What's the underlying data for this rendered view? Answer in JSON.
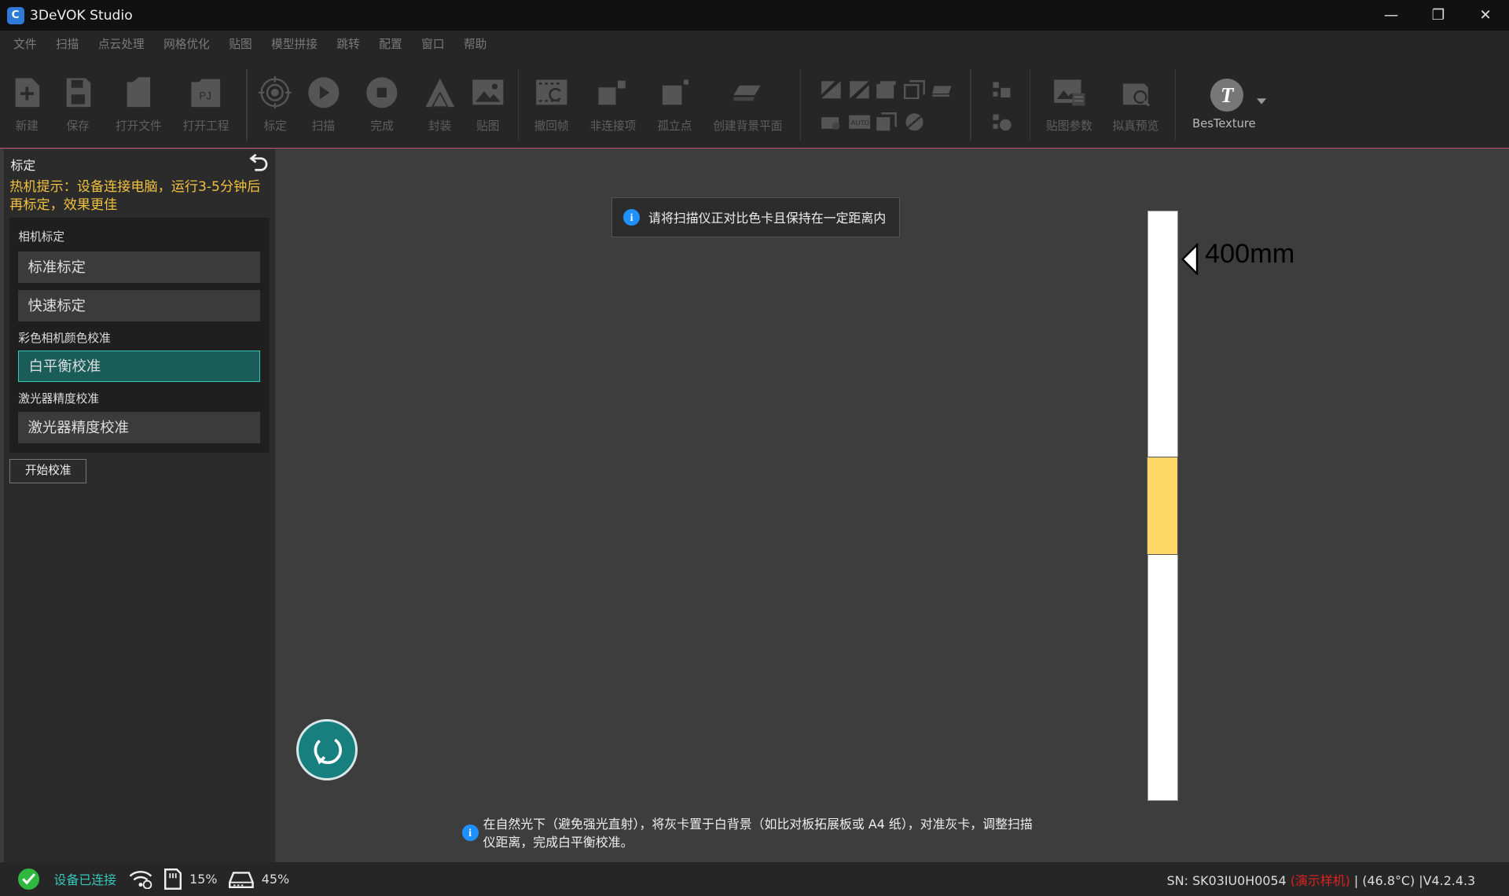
{
  "window": {
    "title": "3DeVOK Studio",
    "logo_letter": "C",
    "controls": {
      "minimize": "—",
      "restore": "❐",
      "close": "✕"
    }
  },
  "menu": [
    "文件",
    "扫描",
    "点云处理",
    "网格优化",
    "贴图",
    "模型拼接",
    "跳转",
    "配置",
    "窗口",
    "帮助"
  ],
  "toolbar": {
    "new": "新建",
    "save": "保存",
    "open_file": "打开文件",
    "open_project": "打开工程",
    "open_project_icon_text": "PJ",
    "calibrate": "标定",
    "scan": "扫描",
    "finish": "完成",
    "encapsulate": "封装",
    "texture": "贴图",
    "undo_frame": "撤回帧",
    "non_connected": "非连接项",
    "isolated_points": "孤立点",
    "create_bg_plane": "创建背景平面",
    "texture_params": "贴图参数",
    "mock_preview": "拟真预览",
    "bestexture": "BesTexture",
    "bestexture_letter": "T"
  },
  "panel": {
    "title": "标定",
    "tip": "热机提示：设备连接电脑，运行3-5分钟后再标定，效果更佳",
    "camera_section": "相机标定",
    "standard_cal": "标准标定",
    "quick_cal": "快速标定",
    "color_section": "彩色相机颜色校准",
    "white_balance": "白平衡校准",
    "laser_section": "激光器精度校准",
    "laser_cal": "激光器精度校准",
    "start_button": "开始校准"
  },
  "viewport": {
    "toast_text": "请将扫描仪正对比色卡且保持在一定距离内",
    "info_glyph": "i",
    "distance_label": "400mm",
    "distance_fill": {
      "start_fraction": 0.417,
      "end_fraction": 0.584
    },
    "hint_text": "在自然光下（避免强光直射），将灰卡置于白背景（如比对板拓展板或 A4 纸），对准灰卡，调整扫描仪距离，完成白平衡校准。"
  },
  "status": {
    "connected": "设备已连接",
    "storage_pct": "15%",
    "memory_pct": "45%",
    "sn_prefix": "SN: SK03IU0H0054 ",
    "demo_tag": "(演示样机)",
    "temp_version": " | (46.8°C) |V4.2.4.3"
  },
  "colors": {
    "accent_teal": "#36c7b8",
    "warning_yellow": "#f0c040",
    "gauge_fill": "#ffd766",
    "demo_red": "#e02020"
  }
}
